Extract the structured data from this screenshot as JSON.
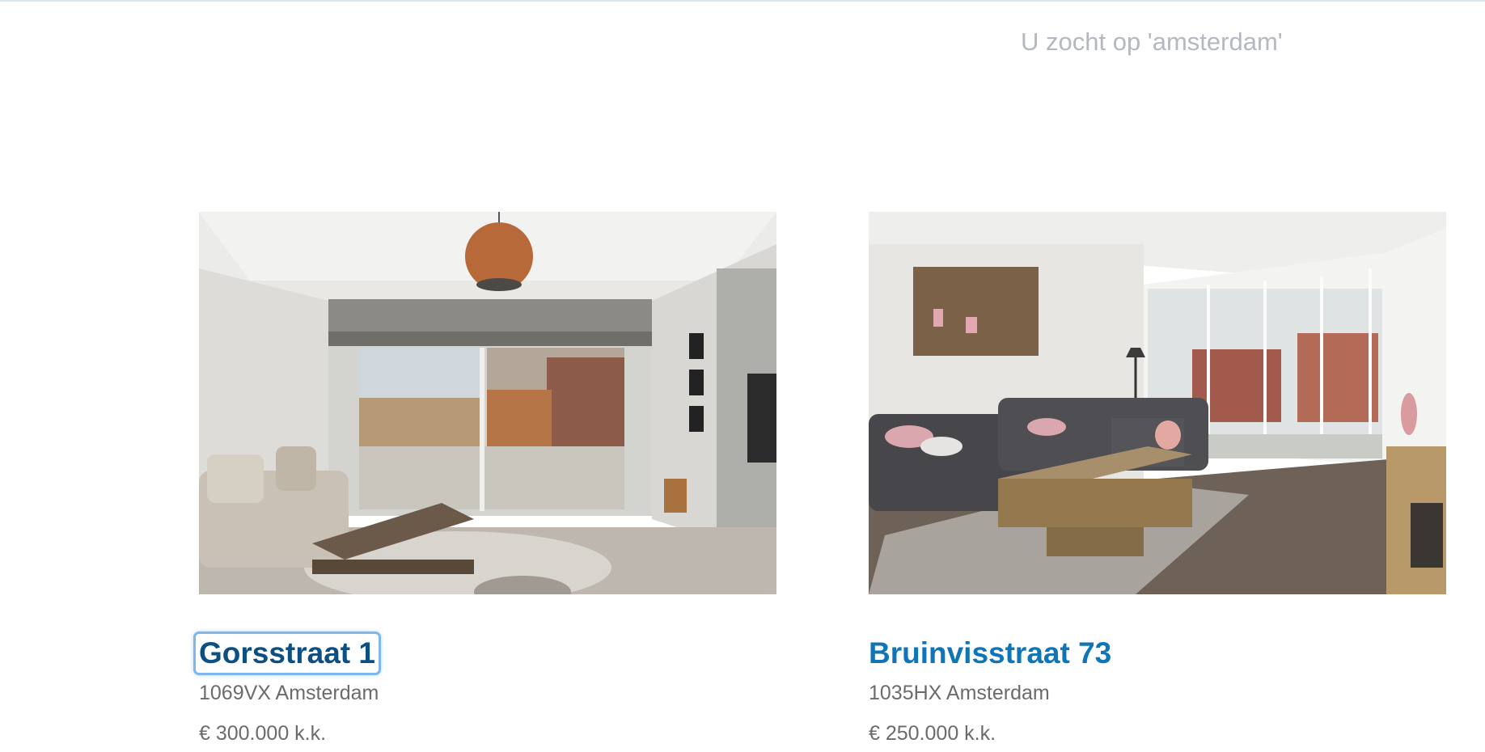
{
  "search": {
    "summary": "U zocht op 'amsterdam'"
  },
  "listings": [
    {
      "title": "Gorsstraat 1",
      "address": "1069VX Amsterdam",
      "price": "€ 300.000 k.k.",
      "focused": true
    },
    {
      "title": "Bruinvisstraat 73",
      "address": "1035HX Amsterdam",
      "price": "€ 250.000 k.k.",
      "focused": false
    }
  ],
  "colors": {
    "link": "#0e76b8",
    "link_focused": "#0b4f83",
    "muted_text": "#6b6b6b",
    "search_text": "#b3b8c1"
  }
}
